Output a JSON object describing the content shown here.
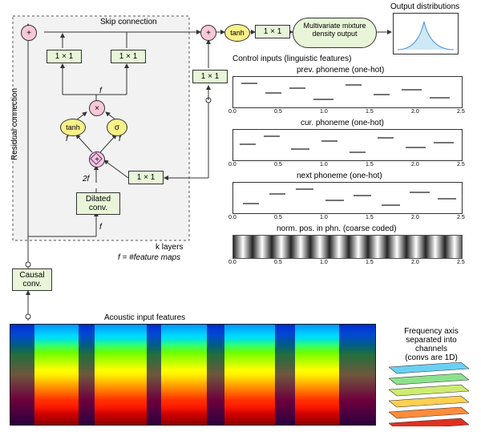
{
  "labels": {
    "skip": "Skip connection",
    "residual": "Residual connection",
    "outdist": "Output distributions",
    "ctrl": "Control inputs (linguistic features)",
    "prevphon": "prev. phoneme (one-hot)",
    "curphon": "cur. phoneme (one-hot)",
    "nextphon": "next phoneme (one-hot)",
    "normpos": "norm. pos. in phn. (coarse coded)",
    "klayers": "k layers",
    "fmaps": "f = #feature maps",
    "acoustic": "Acoustic input features",
    "freqaxis1": "Frequency axis",
    "freqaxis2": "separated into channels",
    "freqaxis3": "(convs are 1D)",
    "conv1x1": "1 × 1",
    "dilated": "Dilated\nconv.",
    "causal": "Causal\nconv.",
    "tanh": "tanh",
    "sigma": "σ",
    "f": "f",
    "2f": "2f",
    "mdn": "Multivariate mixture\ndensity output"
  },
  "ticks": [
    "0.0",
    "0.5",
    "1.0",
    "1.5",
    "2.0",
    "2.5"
  ]
}
